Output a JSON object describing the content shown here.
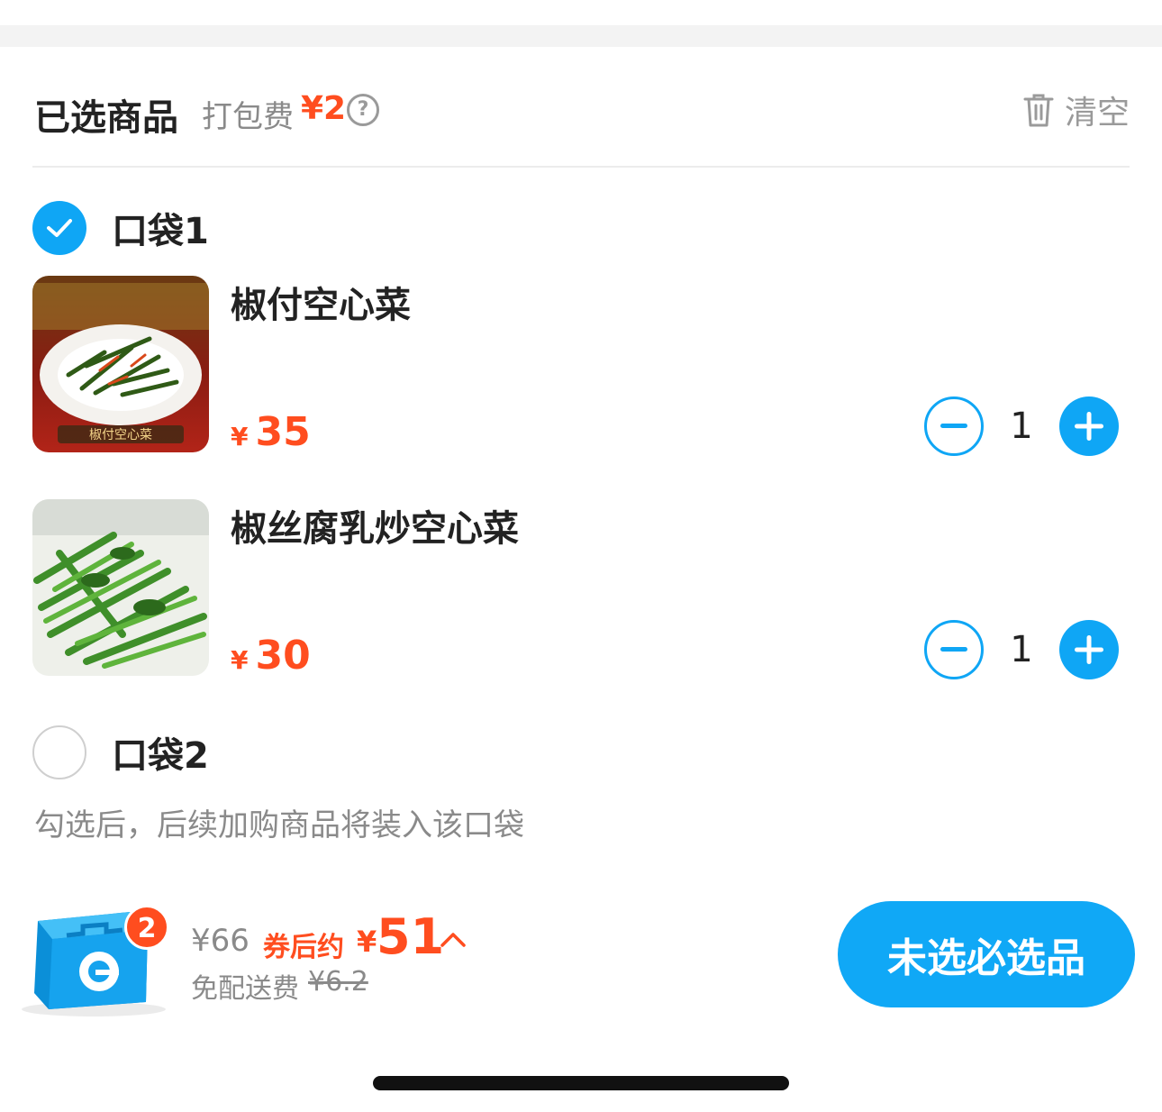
{
  "header": {
    "title": "已选商品",
    "fee_label": "打包费",
    "fee_value": "¥2",
    "clear_label": "清空"
  },
  "pockets": [
    {
      "label": "口袋1",
      "checked": true,
      "items": [
        {
          "name": "椒付空心菜",
          "price_currency": "¥",
          "price": "35",
          "quantity": "1",
          "image_caption": "椒付空心菜"
        },
        {
          "name": "椒丝腐乳炒空心菜",
          "price_currency": "¥",
          "price": "30",
          "quantity": "1"
        }
      ]
    },
    {
      "label": "口袋2",
      "checked": false,
      "items": []
    }
  ],
  "hint": "勾选后，后续加购商品将装入该口袋",
  "footer": {
    "cart_count": "2",
    "original_price": "¥66",
    "after_coupon_label": "券后约",
    "after_coupon_currency": "¥",
    "after_coupon_price": "51",
    "delivery_label": "免配送费",
    "delivery_original": "¥6.2",
    "cta_label": "未选必选品"
  },
  "colors": {
    "accent_blue": "#0fa6f5",
    "price_red": "#ff4d1f",
    "muted_text": "#8a8a8a"
  }
}
